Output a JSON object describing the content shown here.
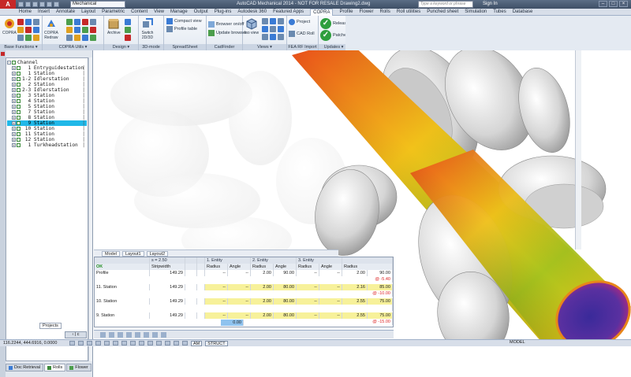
{
  "titlebar": {
    "app_letter": "A",
    "workspace": "Mechanical",
    "title": "AutoCAD Mechanical 2014 - NOT FOR RESALE   Drawing2.dwg",
    "search_placeholder": "Type a keyword or phrase",
    "signin": "Sign In",
    "window_buttons": [
      "–",
      "□",
      "×"
    ]
  },
  "tabs": [
    "Home",
    "Insert",
    "Annotate",
    "Layout",
    "Parametric",
    "Content",
    "View",
    "Manage",
    "Output",
    "Plug-ins",
    "Autodesk 360",
    "Featured Apps",
    "COPRA",
    "Profile",
    "Flower",
    "Rolls",
    "Roll utilities",
    "Punched sheet",
    "Simulation",
    "Tubes",
    "Database"
  ],
  "active_tab": "COPRA",
  "ribbon": {
    "copra_label": "COPRA",
    "copra_redraw": "COPRA\nRedraw",
    "archive": "Archive",
    "switch_2d3d": "Switch\n2D/3D",
    "compact_view": "Compact view",
    "profile_table": "Profile table",
    "browser_onoff": "Browser on/off",
    "update_browser": "Update browser",
    "iso_view": "Iso view",
    "project": "Project",
    "cad_roll": "CAD Roll",
    "release": "Release",
    "patches": "Patches",
    "panels": [
      "Base Functions ▾",
      "COPRA Utils ▾",
      "Design ▾",
      "3D-mode",
      "SpreadSheet",
      "CadFinder",
      "Views ▾",
      "FEA RF Import",
      "Updates ▾"
    ]
  },
  "tree": {
    "items": [
      {
        "pm": "−",
        "text": "Channel",
        "bar": "",
        "root": true
      },
      {
        "pm": "+",
        "text": "  1 Entryguidestation",
        "bar": "|"
      },
      {
        "pm": "+",
        "text": "  1 Station",
        "bar": "|"
      },
      {
        "pm": "+",
        "text": "1-2 Idlerstation",
        "bar": "|"
      },
      {
        "pm": "+",
        "text": "  2 Station",
        "bar": "|"
      },
      {
        "pm": "+",
        "text": "2-3 Idlerstation",
        "bar": "|"
      },
      {
        "pm": "+",
        "text": "  3 Station",
        "bar": "|"
      },
      {
        "pm": "+",
        "text": "  4 Station",
        "bar": "|"
      },
      {
        "pm": "+",
        "text": "  5 Station",
        "bar": "|"
      },
      {
        "pm": "+",
        "text": "  7 Station",
        "bar": "|"
      },
      {
        "pm": "+",
        "text": "  8 Station",
        "bar": "|"
      },
      {
        "pm": "+",
        "text": "  9 Station",
        "bar": "|",
        "selected": true
      },
      {
        "pm": "+",
        "text": " 10 Station",
        "bar": "|"
      },
      {
        "pm": "+",
        "text": " 11 Station",
        "bar": "|"
      },
      {
        "pm": "+",
        "text": " 12 Station",
        "bar": "|"
      },
      {
        "pm": "+",
        "text": "  1 Turkheadstation",
        "bar": "|"
      }
    ],
    "tabs": [
      "Doc Retrieval",
      "Rolls",
      "Flower"
    ],
    "projects_tab": "Projects",
    "close_button": "‹ | c"
  },
  "layout_tabs": [
    "Model",
    "Layout1",
    "Layout2"
  ],
  "grid": {
    "s_value": "s = 2.50",
    "headers": [
      "",
      "Stripwidth",
      "",
      "",
      "1. Entity",
      "",
      "2. Entity",
      "",
      "3. Entity",
      ""
    ],
    "subheaders": [
      "Radius",
      "Angle",
      "Radius",
      "Angle",
      "Radius",
      "Angle",
      "Radius"
    ],
    "ok": "OK",
    "rows": [
      {
        "name": "Profile",
        "stripwidth": "149.29",
        "r1": "--",
        "a1": "--",
        "r2": "2.00",
        "a2": "90.00",
        "r3": "--",
        "a3": "--",
        "r4": "2.00",
        "v1": "90.00",
        "v2": "@ -5.40"
      },
      {
        "name": "11. Station",
        "stripwidth": "149.29",
        "r1": "--",
        "a1": "--",
        "r2": "2.00",
        "a2": "80.00",
        "r3": "--",
        "a3": "--",
        "r4": "2.16",
        "v1": "85.00",
        "v2": "@ -10.00"
      },
      {
        "name": "10. Station",
        "stripwidth": "149.29",
        "r1": "--",
        "a1": "--",
        "r2": "2.00",
        "a2": "80.00",
        "r3": "--",
        "a3": "--",
        "r4": "2.55",
        "v1": "75.00",
        "v2": ""
      },
      {
        "name": "9. Station",
        "stripwidth": "149.29",
        "r1": "--",
        "a1": "--",
        "r2": "2.00",
        "a2": "80.00",
        "r3": "--",
        "a3": "--",
        "r4": "2.55",
        "v1": "75.00",
        "v2": "@ -15.00"
      }
    ],
    "blue_value": "0.00"
  },
  "statusbar": {
    "coords": "116.2244, 444.6916, 0.0000",
    "labels": [
      "INFER",
      "SNAP",
      "GRID",
      "ORTHO",
      "POLAR",
      "OSNAP",
      "3DOSNAP",
      "OTRACK",
      "DUCS",
      "DYN",
      "LWT",
      "TPY",
      "QP",
      "SC",
      "AM",
      "STRUCT"
    ],
    "model": "MODEL"
  },
  "colors": {
    "accent_blue": "#20b8e8",
    "ok_green": "#1e8c1e",
    "grid_yellow": "#f7f19a",
    "logo_red": "#c62828"
  }
}
